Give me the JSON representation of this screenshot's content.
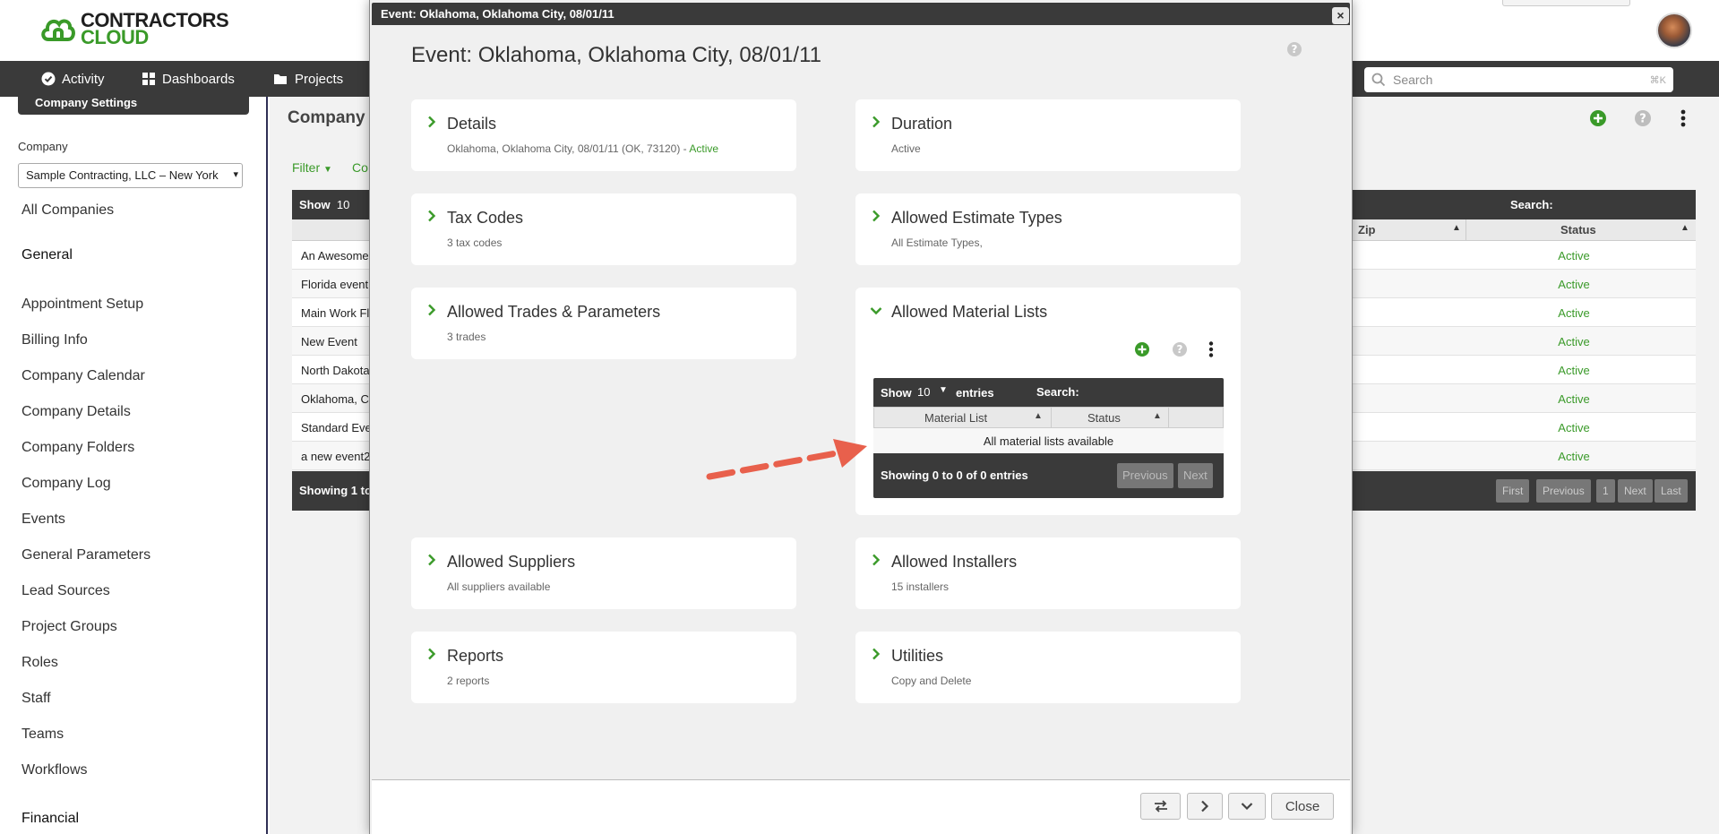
{
  "app": {
    "logo_line1": "CONTRACTORS",
    "logo_line2": "CLOUD",
    "brand_color": "#3a9a29"
  },
  "nav": {
    "items": [
      {
        "label": "Activity",
        "icon": "check-circle-icon"
      },
      {
        "label": "Dashboards",
        "icon": "grid-icon"
      },
      {
        "label": "Projects",
        "icon": "folder-icon"
      }
    ],
    "search_placeholder": "Search",
    "search_shortcut": "⌘K"
  },
  "sidebar": {
    "section_tab": "Company Settings",
    "company_label": "Company",
    "company_value": "Sample Contracting, LLC – New York",
    "all_companies": "All Companies",
    "general_heading": "General",
    "items": [
      "Appointment Setup",
      "Billing Info",
      "Company Calendar",
      "Company Details",
      "Company Folders",
      "Company Log",
      "Events",
      "General Parameters",
      "Lead Sources",
      "Project Groups",
      "Roles",
      "Staff",
      "Teams",
      "Workflows"
    ],
    "financial_heading": "Financial"
  },
  "page": {
    "title": "Company",
    "filter_label": "Filter",
    "co_label": "Co",
    "table_show": "Show",
    "table_show_value": "10",
    "table_search": "Search:",
    "col_zip": "Zip",
    "col_status": "Status",
    "rows": [
      {
        "name": "An Awesome",
        "status": "Active"
      },
      {
        "name": "Florida event",
        "status": "Active"
      },
      {
        "name": "Main Work Fl",
        "status": "Active"
      },
      {
        "name": "New Event",
        "status": "Active"
      },
      {
        "name": "North Dakota",
        "status": "Active"
      },
      {
        "name": "Oklahoma, C",
        "status": "Active"
      },
      {
        "name": "Standard Eve",
        "status": "Active"
      },
      {
        "name": "a new event2",
        "status": "Active"
      }
    ],
    "showing": "Showing 1 to",
    "pager": [
      "First",
      "Previous",
      "1",
      "Next",
      "Last"
    ]
  },
  "modal": {
    "titlebar": "Event: Oklahoma, Oklahoma City, 08/01/11",
    "close_x": "×",
    "heading": "Event: Oklahoma, Oklahoma City, 08/01/11",
    "cards": {
      "details": {
        "title": "Details",
        "subtitle": "Oklahoma, Oklahoma City, 08/01/11 (OK, 73120) - ",
        "status": "Active"
      },
      "duration": {
        "title": "Duration",
        "subtitle": "Active"
      },
      "tax_codes": {
        "title": "Tax Codes",
        "subtitle": "3 tax codes"
      },
      "estimate_types": {
        "title": "Allowed Estimate Types",
        "subtitle": "All Estimate Types,"
      },
      "trades": {
        "title": "Allowed Trades & Parameters",
        "subtitle": "3 trades"
      },
      "material_lists": {
        "title": "Allowed Material Lists"
      },
      "suppliers": {
        "title": "Allowed Suppliers",
        "subtitle": "All suppliers available"
      },
      "installers": {
        "title": "Allowed Installers",
        "subtitle": "15 installers"
      },
      "reports": {
        "title": "Reports",
        "subtitle": "2 reports"
      },
      "utilities": {
        "title": "Utilities",
        "subtitle": "Copy and Delete"
      }
    },
    "material_table": {
      "show": "Show",
      "show_value": "10",
      "entries": "entries",
      "search": "Search:",
      "col_material": "Material List",
      "col_status": "Status",
      "empty": "All material lists available",
      "showing": "Showing 0 to 0 of 0 entries",
      "previous": "Previous",
      "next": "Next"
    },
    "close_button": "Close"
  }
}
